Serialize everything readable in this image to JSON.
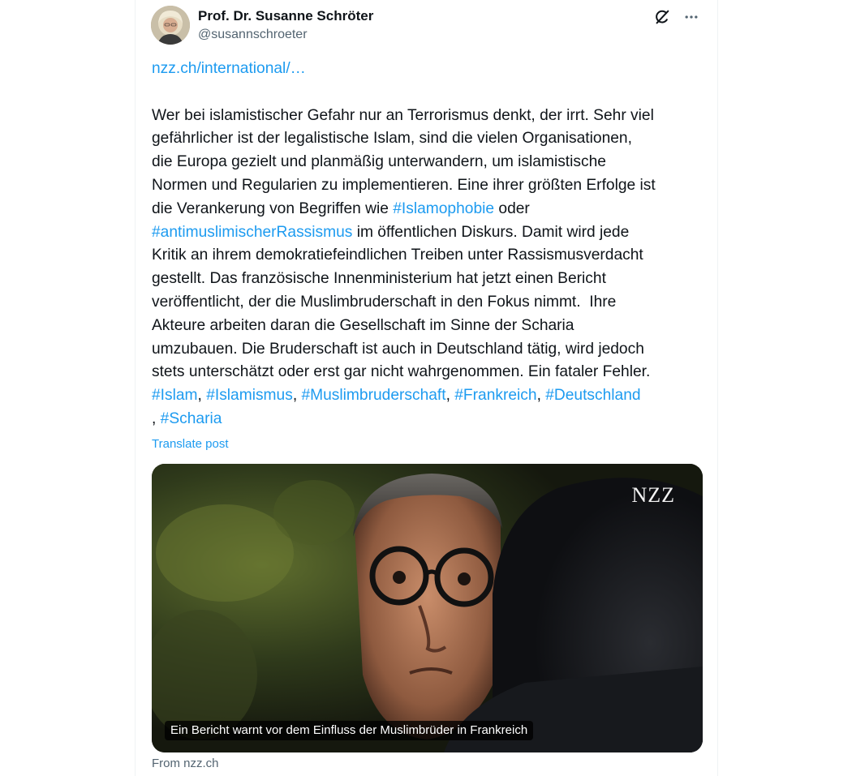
{
  "author": {
    "display_name": "Prof. Dr. Susanne Schröter",
    "handle": "@susannschroeter"
  },
  "icons": {
    "grok": "grok-icon",
    "more": "more-icon"
  },
  "post": {
    "link": "nzz.ch/international/…",
    "text_1": "Wer bei islamistischer Gefahr nur an Terrorismus denkt, der irrt. Sehr viel\ngefährlicher ist der legalistische Islam, sind die vielen Organisationen,\ndie Europa gezielt und planmäßig unterwandern, um islamistische\nNormen und Regularien zu implementieren. Eine ihrer größten Erfolge ist\ndie Verankerung von Begriffen wie ",
    "hashtag_islamophobie": "#Islamophobie",
    "text_2": " oder\n",
    "hashtag_antimuslim": "#antimuslimischerRassismus",
    "text_3": " im öffentlichen Diskurs. Damit wird jede\nKritik an ihrem demokratiefeindlichen Treiben unter Rassismusverdacht\ngestellt. Das französische Innenministerium hat jetzt einen Bericht\nveröffentlicht, der die Muslimbruderschaft in den Fokus nimmt.  Ihre\nAkteure arbeiten daran die Gesellschaft im Sinne der Scharia\numzubauen. Die Bruderschaft ist auch in Deutschland tätig, wird jedoch\nstets unterschätzt oder erst gar nicht wahrgenommen. Ein fataler Fehler.\n",
    "hashtags": [
      "#Islam",
      "#Islamismus",
      "#Muslimbruderschaft",
      "#Frankreich",
      "#Deutschland",
      "#Scharia"
    ],
    "sep": ", ",
    "sep_break": "\n, "
  },
  "translate_label": "Translate post",
  "card": {
    "logo": "NZZ",
    "caption": "Ein Bericht warnt vor dem Einfluss der Muslimbrüder in Frankreich",
    "source": "From nzz.ch"
  },
  "colors": {
    "link": "#1d9bf0",
    "text": "#0f1419",
    "secondary": "#536471"
  }
}
